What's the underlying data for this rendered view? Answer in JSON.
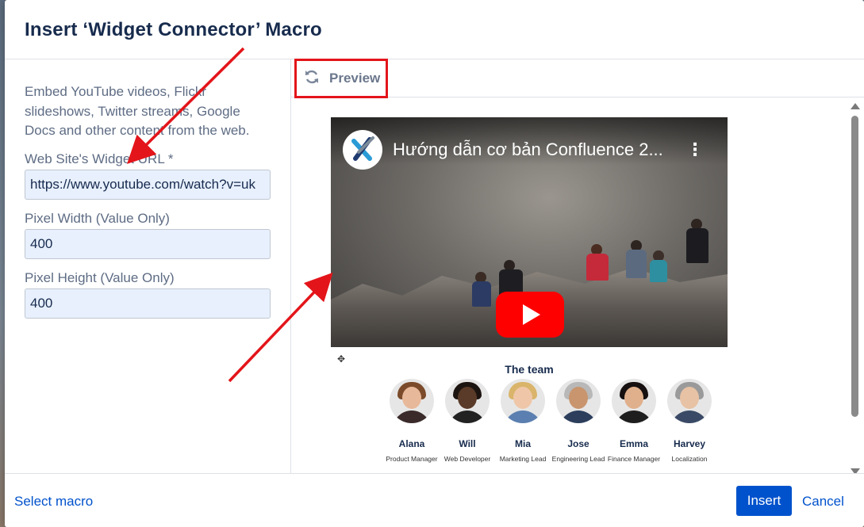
{
  "dialog": {
    "title": "Insert ‘Widget Connector’ Macro"
  },
  "form": {
    "description": "Embed YouTube videos, Flickr slideshows, Twitter streams, Google Docs and other content from the web.",
    "url_label": "Web Site's Widget URL *",
    "url_value": "https://www.youtube.com/watch?v=uk",
    "width_label": "Pixel Width (Value Only)",
    "width_value": "400",
    "height_label": "Pixel Height (Value Only)",
    "height_value": "400"
  },
  "preview": {
    "button_label": "Preview",
    "refresh_icon": "refresh-icon",
    "video": {
      "title": "Hướng dẫn cơ bản Confluence 2...",
      "menu_glyph": "⋮",
      "play_icon": "youtube-play-icon"
    },
    "team": {
      "move_glyph": "✥",
      "title": "The team",
      "members": [
        {
          "name": "Alana",
          "role": "Product Manager"
        },
        {
          "name": "Will",
          "role": "Web Developer"
        },
        {
          "name": "Mia",
          "role": "Marketing Lead"
        },
        {
          "name": "Jose",
          "role": "Engineering Lead"
        },
        {
          "name": "Emma",
          "role": "Finance Manager"
        },
        {
          "name": "Harvey",
          "role": "Localization"
        }
      ]
    }
  },
  "footer": {
    "select_macro": "Select macro",
    "insert": "Insert",
    "cancel": "Cancel"
  },
  "colors": {
    "primary": "#0052cc",
    "title": "#172b4d",
    "muted": "#5e6c84",
    "annotation": "#e3151a",
    "input_bg": "#e8f0fe",
    "youtube_red": "#ff0000"
  }
}
